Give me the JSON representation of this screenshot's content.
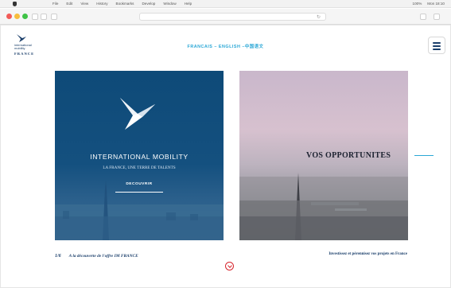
{
  "menubar": {
    "items": [
      "File",
      "Edit",
      "View",
      "History",
      "Bookmarks",
      "Develop",
      "Window",
      "Help"
    ],
    "right_items": [
      "100%",
      "Mon 18:10"
    ]
  },
  "header": {
    "logo": {
      "line1": "international",
      "line2": "mobility",
      "line3": "FRANCE"
    },
    "languages": {
      "fr": "FRANCAIS",
      "sep1": " – ",
      "en": "ENGLISH",
      "sep2": " –",
      "zh": "中国语文"
    }
  },
  "cards": {
    "left": {
      "title": "INTERNATIONAL MOBILITY",
      "subtitle": "LA FRANCE, UNE TERRE DE TALENTS",
      "cta": "DECOUVRIR"
    },
    "right": {
      "title": "VOS OPPORTUNITES"
    }
  },
  "captions": {
    "counter": "1/6",
    "left_text": "A la découverte de l'offre IM FRANCE",
    "right_text": "Investissez et pérennisez vos projets en France"
  },
  "colors": {
    "accent": "#2aa7d6",
    "brand_navy": "#1b3f6b",
    "scroll_red": "#d7262e"
  }
}
